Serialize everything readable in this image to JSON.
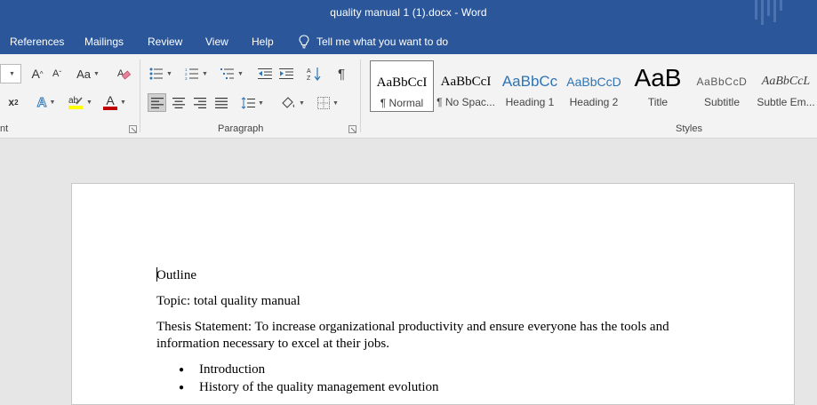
{
  "window": {
    "title": "quality manual 1 (1).docx  -  Word"
  },
  "tabs": [
    {
      "label": "References"
    },
    {
      "label": "Mailings"
    },
    {
      "label": "Review"
    },
    {
      "label": "View"
    },
    {
      "label": "Help"
    }
  ],
  "tell_me": {
    "label": "Tell me what you want to do",
    "icon": "lightbulb-icon"
  },
  "ribbon": {
    "font_group_label": "nt",
    "paragraph_group_label": "Paragraph",
    "styles_group_label": "Styles",
    "grow_font": "A",
    "shrink_font": "A",
    "change_case": "Aa",
    "superscript": "x",
    "text_effects": "A",
    "font_color": "A",
    "highlight_color": "#ffff00",
    "font_color_value": "#c00000"
  },
  "styles": [
    {
      "preview": "AaBbCcI",
      "name": "¶ Normal",
      "color": "#000000",
      "selected": true
    },
    {
      "preview": "AaBbCcI",
      "name": "¶ No Spac...",
      "color": "#000000",
      "selected": false
    },
    {
      "preview": "AaBbCc",
      "name": "Heading 1",
      "color": "#2e74b5",
      "selected": false
    },
    {
      "preview": "AaBbCcD",
      "name": "Heading 2",
      "color": "#2e74b5",
      "selected": false
    },
    {
      "preview": "AaB",
      "name": "Title",
      "color": "#000000",
      "selected": false
    },
    {
      "preview": "AaBbCcD",
      "name": "Subtitle",
      "color": "#595959",
      "selected": false
    },
    {
      "preview": "AaBbCcL",
      "name": "Subtle Em...",
      "color": "#404040",
      "selected": false
    }
  ],
  "document": {
    "heading": "Outline",
    "topic": "Topic: total quality manual",
    "thesis": "Thesis Statement:  To increase organizational productivity and ensure everyone has the tools and information necessary to excel at their jobs.",
    "bullets": [
      "Introduction",
      "History of the quality management evolution"
    ]
  }
}
